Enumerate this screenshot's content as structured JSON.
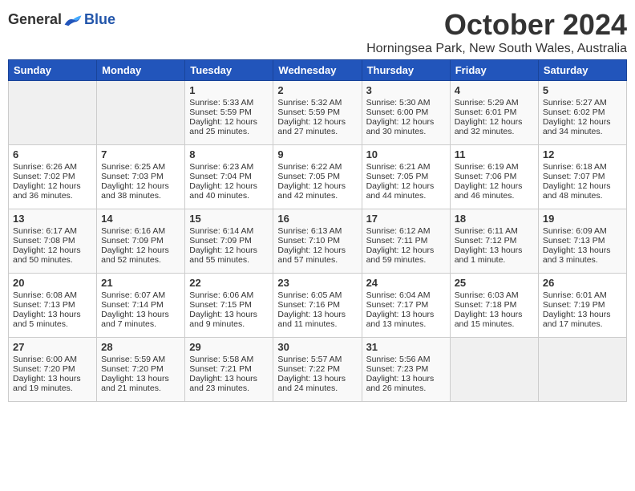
{
  "logo": {
    "general": "General",
    "blue": "Blue"
  },
  "header": {
    "month": "October 2024",
    "location": "Horningsea Park, New South Wales, Australia"
  },
  "weekdays": [
    "Sunday",
    "Monday",
    "Tuesday",
    "Wednesday",
    "Thursday",
    "Friday",
    "Saturday"
  ],
  "weeks": [
    [
      {
        "day": "",
        "content": ""
      },
      {
        "day": "",
        "content": ""
      },
      {
        "day": "1",
        "content": "Sunrise: 5:33 AM\nSunset: 5:59 PM\nDaylight: 12 hours\nand 25 minutes."
      },
      {
        "day": "2",
        "content": "Sunrise: 5:32 AM\nSunset: 5:59 PM\nDaylight: 12 hours\nand 27 minutes."
      },
      {
        "day": "3",
        "content": "Sunrise: 5:30 AM\nSunset: 6:00 PM\nDaylight: 12 hours\nand 30 minutes."
      },
      {
        "day": "4",
        "content": "Sunrise: 5:29 AM\nSunset: 6:01 PM\nDaylight: 12 hours\nand 32 minutes."
      },
      {
        "day": "5",
        "content": "Sunrise: 5:27 AM\nSunset: 6:02 PM\nDaylight: 12 hours\nand 34 minutes."
      }
    ],
    [
      {
        "day": "6",
        "content": "Sunrise: 6:26 AM\nSunset: 7:02 PM\nDaylight: 12 hours\nand 36 minutes."
      },
      {
        "day": "7",
        "content": "Sunrise: 6:25 AM\nSunset: 7:03 PM\nDaylight: 12 hours\nand 38 minutes."
      },
      {
        "day": "8",
        "content": "Sunrise: 6:23 AM\nSunset: 7:04 PM\nDaylight: 12 hours\nand 40 minutes."
      },
      {
        "day": "9",
        "content": "Sunrise: 6:22 AM\nSunset: 7:05 PM\nDaylight: 12 hours\nand 42 minutes."
      },
      {
        "day": "10",
        "content": "Sunrise: 6:21 AM\nSunset: 7:05 PM\nDaylight: 12 hours\nand 44 minutes."
      },
      {
        "day": "11",
        "content": "Sunrise: 6:19 AM\nSunset: 7:06 PM\nDaylight: 12 hours\nand 46 minutes."
      },
      {
        "day": "12",
        "content": "Sunrise: 6:18 AM\nSunset: 7:07 PM\nDaylight: 12 hours\nand 48 minutes."
      }
    ],
    [
      {
        "day": "13",
        "content": "Sunrise: 6:17 AM\nSunset: 7:08 PM\nDaylight: 12 hours\nand 50 minutes."
      },
      {
        "day": "14",
        "content": "Sunrise: 6:16 AM\nSunset: 7:09 PM\nDaylight: 12 hours\nand 52 minutes."
      },
      {
        "day": "15",
        "content": "Sunrise: 6:14 AM\nSunset: 7:09 PM\nDaylight: 12 hours\nand 55 minutes."
      },
      {
        "day": "16",
        "content": "Sunrise: 6:13 AM\nSunset: 7:10 PM\nDaylight: 12 hours\nand 57 minutes."
      },
      {
        "day": "17",
        "content": "Sunrise: 6:12 AM\nSunset: 7:11 PM\nDaylight: 12 hours\nand 59 minutes."
      },
      {
        "day": "18",
        "content": "Sunrise: 6:11 AM\nSunset: 7:12 PM\nDaylight: 13 hours\nand 1 minute."
      },
      {
        "day": "19",
        "content": "Sunrise: 6:09 AM\nSunset: 7:13 PM\nDaylight: 13 hours\nand 3 minutes."
      }
    ],
    [
      {
        "day": "20",
        "content": "Sunrise: 6:08 AM\nSunset: 7:13 PM\nDaylight: 13 hours\nand 5 minutes."
      },
      {
        "day": "21",
        "content": "Sunrise: 6:07 AM\nSunset: 7:14 PM\nDaylight: 13 hours\nand 7 minutes."
      },
      {
        "day": "22",
        "content": "Sunrise: 6:06 AM\nSunset: 7:15 PM\nDaylight: 13 hours\nand 9 minutes."
      },
      {
        "day": "23",
        "content": "Sunrise: 6:05 AM\nSunset: 7:16 PM\nDaylight: 13 hours\nand 11 minutes."
      },
      {
        "day": "24",
        "content": "Sunrise: 6:04 AM\nSunset: 7:17 PM\nDaylight: 13 hours\nand 13 minutes."
      },
      {
        "day": "25",
        "content": "Sunrise: 6:03 AM\nSunset: 7:18 PM\nDaylight: 13 hours\nand 15 minutes."
      },
      {
        "day": "26",
        "content": "Sunrise: 6:01 AM\nSunset: 7:19 PM\nDaylight: 13 hours\nand 17 minutes."
      }
    ],
    [
      {
        "day": "27",
        "content": "Sunrise: 6:00 AM\nSunset: 7:20 PM\nDaylight: 13 hours\nand 19 minutes."
      },
      {
        "day": "28",
        "content": "Sunrise: 5:59 AM\nSunset: 7:20 PM\nDaylight: 13 hours\nand 21 minutes."
      },
      {
        "day": "29",
        "content": "Sunrise: 5:58 AM\nSunset: 7:21 PM\nDaylight: 13 hours\nand 23 minutes."
      },
      {
        "day": "30",
        "content": "Sunrise: 5:57 AM\nSunset: 7:22 PM\nDaylight: 13 hours\nand 24 minutes."
      },
      {
        "day": "31",
        "content": "Sunrise: 5:56 AM\nSunset: 7:23 PM\nDaylight: 13 hours\nand 26 minutes."
      },
      {
        "day": "",
        "content": ""
      },
      {
        "day": "",
        "content": ""
      }
    ]
  ]
}
